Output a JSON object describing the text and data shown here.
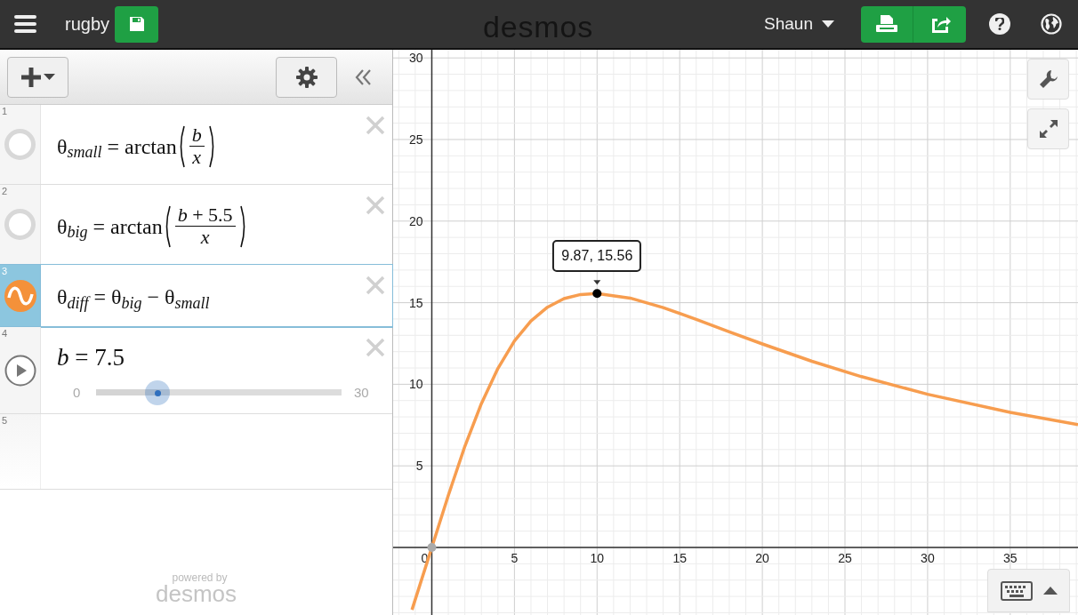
{
  "header": {
    "title": "rugby",
    "logo": "desmos",
    "user": "Shaun"
  },
  "expressions": [
    {
      "number": "1",
      "kind": "fraction",
      "selected": false,
      "left": "θ$_{small}$ = arctan",
      "numerator": "b",
      "denominator": "x"
    },
    {
      "number": "2",
      "kind": "fraction",
      "selected": false,
      "left": "θ$_{big}$ = arctan",
      "numerator": "*b* + 5.5",
      "denominator": "x"
    },
    {
      "number": "3",
      "kind": "plain",
      "color": "#f4913a",
      "selected": true,
      "text": "θ$_{diff}$ = θ$_{big}$ − θ$_{small}$"
    },
    {
      "number": "4",
      "kind": "slider",
      "selected": false,
      "text": "*b* = 7.5",
      "min": "0",
      "max": "30",
      "level": 0.25
    },
    {
      "number": "5",
      "kind": "empty",
      "selected": false
    }
  ],
  "branding": {
    "caption": "powered by",
    "logo": "desmos"
  },
  "graph": {
    "point_label": "9.87, 15.56",
    "chart_data": {
      "type": "line",
      "grid": true,
      "x": [
        -1.2,
        0,
        1,
        2,
        3,
        4,
        5,
        6,
        7,
        8,
        9,
        10,
        12,
        14,
        16,
        18,
        20,
        23,
        26,
        30,
        35,
        39.1
      ],
      "series": [
        {
          "color": "#f79d4f",
          "values": [
            -3.82,
            0,
            3.2,
            6.19,
            8.81,
            10.97,
            12.65,
            13.88,
            14.72,
            15.25,
            15.5,
            15.56,
            15.28,
            14.7,
            13.98,
            13.22,
            12.47,
            11.41,
            10.47,
            9.39,
            8.28,
            7.53
          ]
        }
      ],
      "xlim": [
        -2.34,
        39.1
      ],
      "ylim": [
        -4.14,
        30.5
      ],
      "xticks": [
        0,
        5,
        10,
        15,
        20,
        25,
        30,
        35
      ],
      "yticks": [
        5,
        10,
        15,
        20,
        25,
        30
      ]
    }
  }
}
